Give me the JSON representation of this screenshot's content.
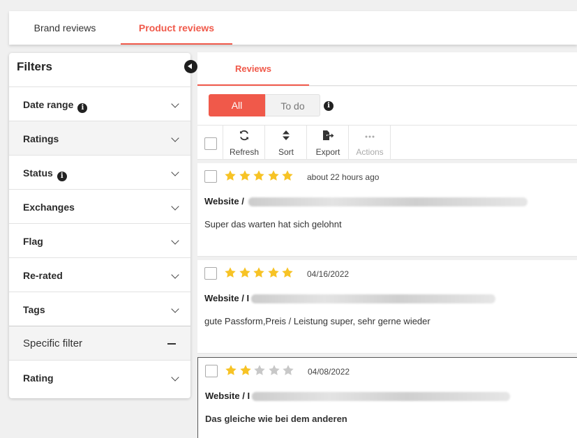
{
  "top_tabs": [
    {
      "label": "Brand reviews"
    },
    {
      "label": "Product reviews"
    }
  ],
  "filters": {
    "title": "Filters",
    "items": [
      {
        "label": "Date range"
      },
      {
        "label": "Ratings"
      },
      {
        "label": "Status"
      },
      {
        "label": "Exchanges"
      },
      {
        "label": "Flag"
      },
      {
        "label": "Re-rated"
      },
      {
        "label": "Tags"
      },
      {
        "label": "Specific filter"
      },
      {
        "label": "Rating"
      }
    ]
  },
  "reviews": {
    "tab_label": "Reviews",
    "segment": {
      "all": "All",
      "todo": "To do"
    },
    "toolbar": {
      "refresh": "Refresh",
      "sort": "Sort",
      "export": "Export",
      "actions": "Actions"
    },
    "items": [
      {
        "rating": 5,
        "date": "about 22 hours ago",
        "source_prefix": "Website / ",
        "text": "Super das warten hat sich gelohnt"
      },
      {
        "rating": 5,
        "date": "04/16/2022",
        "source_prefix": "Website / I",
        "text": "gute Passform,Preis / Leistung super, sehr gerne wieder"
      },
      {
        "rating": 2,
        "date": "04/08/2022",
        "source_prefix": "Website / I",
        "text": "Das gleiche wie bei dem anderen"
      }
    ]
  },
  "colors": {
    "accent": "#f0594a",
    "star_filled": "#f7c325",
    "star_empty": "#c8c8c8"
  },
  "icons": [
    "info-icon",
    "chevron-down-icon",
    "minus-icon",
    "refresh-icon",
    "sort-icon",
    "export-icon",
    "more-horizontal-icon",
    "star-icon",
    "collapse-left-icon"
  ]
}
